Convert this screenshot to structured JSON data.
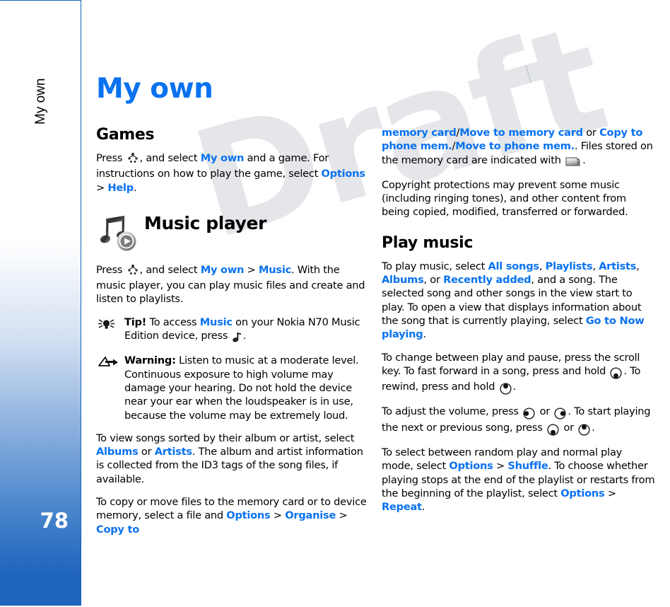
{
  "sidebar": {
    "chapter_label": "My own",
    "page_number": "78",
    "gradient_top": "#ffffff",
    "gradient_bottom": "#1f64bd",
    "border_color": "#1464b4"
  },
  "watermark": {
    "text": "Draft"
  },
  "page": {
    "title": "My own",
    "title_color": "#0a72f0",
    "accent_color": "#0a72f0"
  },
  "left_column": {
    "games_heading": "Games",
    "games_para": {
      "t1": "Press",
      "icon1": "menu-key-icon",
      "t2": ", and select ",
      "b1": "My own",
      "t3": " and a game. For instructions on how to play the game, select ",
      "b2": "Options",
      "gt": " > ",
      "b3": "Help",
      "t4": "."
    },
    "music_player_heading": "Music player",
    "music_player_icon": "music-player-icon",
    "music_para": {
      "t1": "Press",
      "icon1": "menu-key-icon",
      "t2": ", and select ",
      "b1": "My own",
      "gt": " > ",
      "b2": "Music",
      "t3": ". With the music player, you can play music files and create and listen to playlists."
    },
    "tip": {
      "icon": "tip-bulb-icon",
      "label": "Tip!",
      "t1": " To access ",
      "b1": "Music",
      "t2": " on your Nokia N70 Music Edition device, press",
      "icon2": "music-note-key-icon",
      "t3": "."
    },
    "warning": {
      "icon": "warning-triangle-icon",
      "label": "Warning:",
      "text": " Listen to music at a moderate level. Continuous exposure to high volume may damage your hearing. Do not hold the device near your ear when the loudspeaker is in use, because the volume may be extremely loud."
    },
    "sort_para": {
      "t1": "To view songs sorted by their album or artist, select ",
      "b1": "Albums",
      "t2": " or ",
      "b2": "Artists",
      "t3": ". The album and artist information is collected from the ID3 tags of the song files, if available."
    },
    "copy_para": {
      "t1": "To copy or move files to the memory card or to device memory, select a file and ",
      "b1": "Options",
      "gt1": " > ",
      "b2": "Organise",
      "gt2": " > ",
      "b3": "Copy to"
    }
  },
  "right_column": {
    "copy_cont": {
      "b1": "memory card",
      "sep1": "/",
      "b2": "Move to memory card",
      "t1": " or ",
      "b3": "Copy to phone mem.",
      "sep2": "/",
      "b4": "Move to phone mem.",
      "t2": ". Files stored on the memory card are indicated with",
      "icon": "memory-card-icon",
      "t3": "."
    },
    "copyright_para": "Copyright protections may prevent some music (including ringing tones), and other content from being copied, modified, transferred or forwarded.",
    "play_music_heading": "Play music",
    "play_para": {
      "t1": "To play music, select ",
      "b1": "All songs",
      "c1": ", ",
      "b2": "Playlists",
      "c2": ", ",
      "b3": "Artists",
      "c3": ", ",
      "b4": "Albums",
      "t2": ", or ",
      "b5": "Recently added",
      "t3": ", and a song. The selected song and other songs in the view start to play. To open a view that displays information about the song that is currently playing, select ",
      "b6": "Go to Now playing",
      "t4": "."
    },
    "pause_para": {
      "t1": "To change between play and pause, press the scroll key. To fast forward in a song, press and hold",
      "icon1": "scroll-key-down-icon",
      "t2": ". To rewind, press and hold",
      "icon2": "scroll-key-up-icon",
      "t3": "."
    },
    "volume_para": {
      "t1": "To adjust the volume, press",
      "icon1": "scroll-key-left-icon",
      "t2": " or ",
      "icon2": "scroll-key-right-icon",
      "t3": ". To start playing the next or previous song, press",
      "icon3": "scroll-key-down-icon",
      "t4": " or ",
      "icon4": "scroll-key-up-icon",
      "t5": "."
    },
    "shuffle_para": {
      "t1": "To select between random play and normal play mode, select ",
      "b1": "Options",
      "gt1": " > ",
      "b2": "Shuffle",
      "t2": ". To choose whether playing stops at the end of the playlist or restarts from the beginning of the playlist, select ",
      "b3": "Options",
      "gt2": " > ",
      "b4": "Repeat",
      "t3": "."
    }
  }
}
